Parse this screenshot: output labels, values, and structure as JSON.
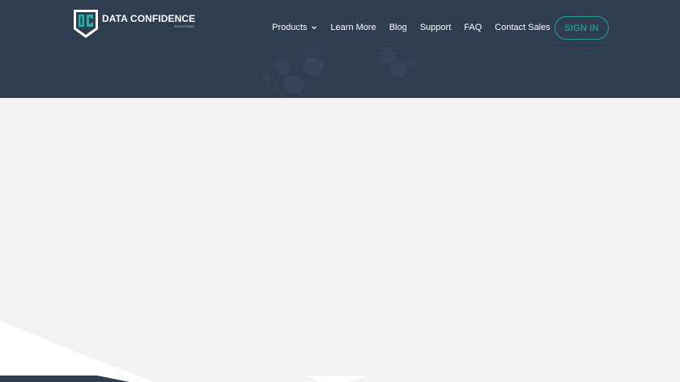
{
  "brand": {
    "name": "DATA CONFIDENCE",
    "tagline": "SOLUTIONS",
    "logo_icon": "dc-shield-logo-icon"
  },
  "nav": {
    "items": [
      {
        "label": "Products",
        "icon": "chevron-down-icon"
      },
      {
        "label": "Learn More"
      },
      {
        "label": "Blog"
      },
      {
        "label": "Support"
      },
      {
        "label": "FAQ"
      },
      {
        "label": "Contact Sales"
      }
    ],
    "signin_label": "SIGN IN"
  },
  "colors": {
    "header_bg": "#2e3d50",
    "accent": "#20b5aa",
    "content_bg": "#f3f3f3"
  }
}
